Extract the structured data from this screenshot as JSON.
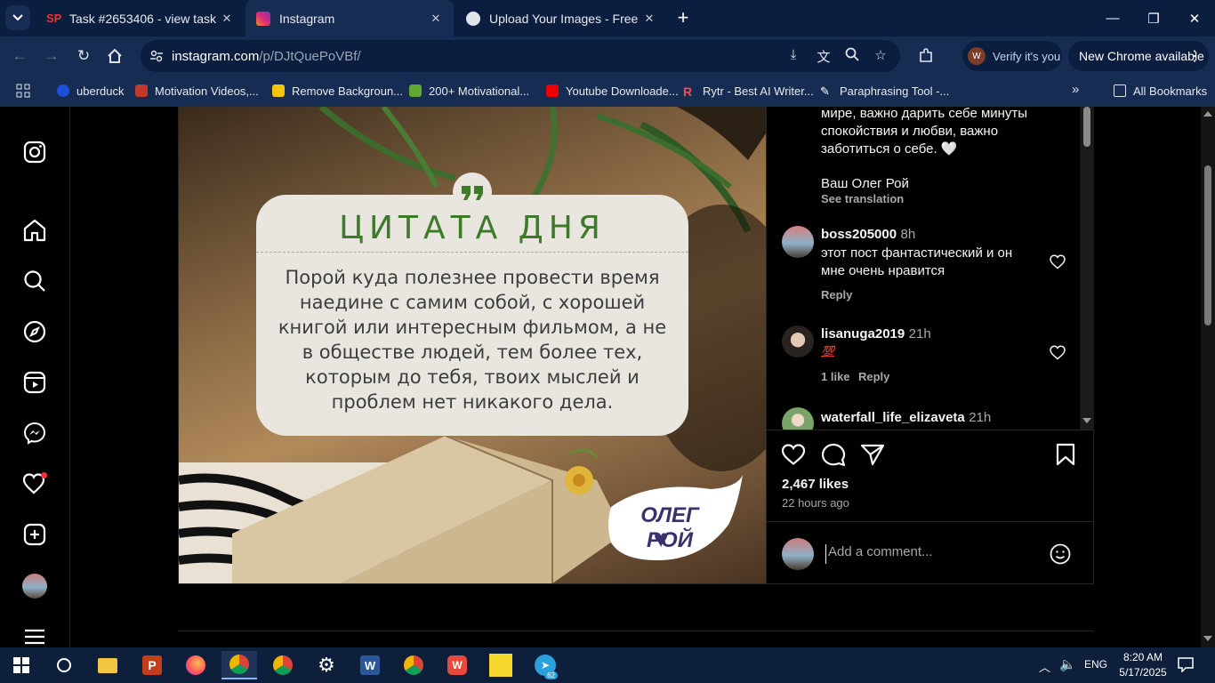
{
  "browser": {
    "tabs": [
      {
        "title": "Task #2653406 - view task",
        "active": false
      },
      {
        "title": "Instagram",
        "active": true
      },
      {
        "title": "Upload Your Images - Free Imag",
        "active": false
      }
    ],
    "url_host": "instagram.com",
    "url_path": "/p/DJtQuePoVBf/",
    "verify_label": "Verify it's you",
    "new_chrome_label": "New Chrome available",
    "bookmarks": [
      "uberduck",
      "Motivation Videos,...",
      "Remove Backgroun...",
      "200+ Motivational...",
      "Youtube Downloade...",
      "Rytr - Best AI Writer...",
      "Paraphrasing Tool -..."
    ],
    "all_bookmarks": "All Bookmarks"
  },
  "photo": {
    "heading": "ЦИТАТА ДНЯ",
    "quote": "Порой куда полезнее провести время наедине с самим собой, с хорошей книгой или интересным фильмом, а не в обществе людей, тем более тех, которым до тебя, твоих мыслей и проблем нет никакого дела.",
    "signature": "ОЛЕГ РОЙ",
    "heart": "♥"
  },
  "caption": {
    "tail": "мире, важно дарить себе минуты спокойствия и любви, важно заботиться о себе. 🤍",
    "sign": "Ваш Олег Рой",
    "see_translation": "See translation"
  },
  "comments": [
    {
      "user": "boss205000",
      "time": "8h",
      "text": "этот пост фантастический и он мне очень нравится",
      "reply": "Reply",
      "likes": ""
    },
    {
      "user": "lisanuga2019",
      "time": "21h",
      "text": "💯",
      "reply": "Reply",
      "likes": "1 like"
    },
    {
      "user": "waterfall_life_elizaveta",
      "time": "21h",
      "text": "",
      "reply": "",
      "likes": ""
    }
  ],
  "actions": {
    "likes": "2,467 likes",
    "posted": "22 hours ago",
    "comment_placeholder": "Add a comment..."
  },
  "taskbar": {
    "time": "8:20 AM",
    "date": "5/17/2025",
    "lang": "ENG",
    "telegram_badge": "62"
  },
  "colors": {
    "browser_dark": "#0b1e3f",
    "browser_mid": "#162c52",
    "quote_green": "#3f7a2b",
    "notification_red": "#ff3040"
  }
}
